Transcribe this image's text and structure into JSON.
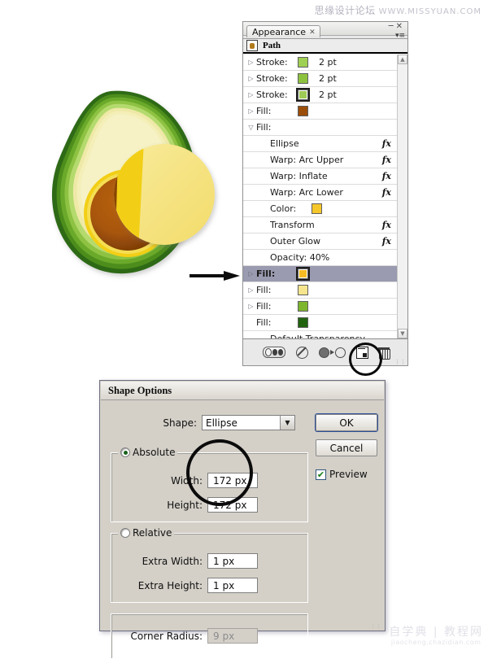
{
  "watermarks": {
    "top_cn": "思缘设计论坛",
    "top_url": "WWW.MISSYUAN.COM",
    "bottom_cn": "自学典 | 教程网",
    "bottom_url": "jiaocheng.chazidian.com"
  },
  "artwork": {
    "name": "avocado-illustration",
    "colors": {
      "skin_dark": "#3e7a1c",
      "skin_mid": "#6aa92b",
      "skin_light": "#9ccc4f",
      "flesh_pale": "#f3efb2",
      "flesh_yellow": "#f6e98f",
      "rim_yellow": "#f4d21f",
      "pit_dark": "#7a3d06",
      "pit_mid": "#a8560a",
      "ellipse_yellow": "#f6e37a",
      "ellipse_band": "#f2cf16"
    }
  },
  "appearance_panel": {
    "window_buttons": [
      "minimize",
      "close"
    ],
    "tab": {
      "label": "Appearance",
      "close_icon": "close-icon"
    },
    "menu_icon": "panel-menu-icon",
    "target_label": "Path",
    "rows": [
      {
        "id": "stroke-1",
        "arrow": "collapsed",
        "label": "Stroke:",
        "swatch": "#9fcf53",
        "ring": false,
        "value": "2 pt",
        "fx": false,
        "indent": false,
        "selected": false
      },
      {
        "id": "stroke-2",
        "arrow": "collapsed",
        "label": "Stroke:",
        "swatch": "#8dc23f",
        "ring": false,
        "value": "2 pt",
        "fx": false,
        "indent": false,
        "selected": false
      },
      {
        "id": "stroke-3",
        "arrow": "collapsed",
        "label": "Stroke:",
        "swatch": "#9ecb55",
        "ring": true,
        "value": "2 pt",
        "fx": false,
        "indent": false,
        "selected": false
      },
      {
        "id": "fill-brown",
        "arrow": "collapsed",
        "label": "Fill:",
        "swatch": "#9a4e09",
        "ring": false,
        "value": "",
        "fx": false,
        "indent": false,
        "selected": false
      },
      {
        "id": "fill-expanded",
        "arrow": "expanded",
        "label": "Fill:",
        "swatch": "",
        "ring": false,
        "value": "",
        "fx": false,
        "indent": false,
        "selected": false
      },
      {
        "id": "effect-ellipse",
        "arrow": "none",
        "label": "Ellipse",
        "swatch": "",
        "ring": false,
        "value": "",
        "fx": true,
        "indent": true,
        "selected": false
      },
      {
        "id": "effect-warp-arc-upper",
        "arrow": "none",
        "label": "Warp: Arc Upper",
        "swatch": "",
        "ring": false,
        "value": "",
        "fx": true,
        "indent": true,
        "selected": false
      },
      {
        "id": "effect-warp-inflate",
        "arrow": "none",
        "label": "Warp: Inflate",
        "swatch": "",
        "ring": false,
        "value": "",
        "fx": true,
        "indent": true,
        "selected": false
      },
      {
        "id": "effect-warp-arc-lower",
        "arrow": "none",
        "label": "Warp: Arc Lower",
        "swatch": "",
        "ring": false,
        "value": "",
        "fx": true,
        "indent": true,
        "selected": false
      },
      {
        "id": "effect-color",
        "arrow": "none",
        "label": "Color:",
        "swatch": "#f5c72b",
        "ring": false,
        "value": "",
        "fx": false,
        "indent": true,
        "selected": false
      },
      {
        "id": "effect-transform",
        "arrow": "none",
        "label": "Transform",
        "swatch": "",
        "ring": false,
        "value": "",
        "fx": true,
        "indent": true,
        "selected": false
      },
      {
        "id": "effect-outer-glow",
        "arrow": "none",
        "label": "Outer Glow",
        "swatch": "",
        "ring": false,
        "value": "",
        "fx": true,
        "indent": true,
        "selected": false
      },
      {
        "id": "effect-opacity",
        "arrow": "none",
        "label": "Opacity: 40%",
        "swatch": "",
        "ring": false,
        "value": "",
        "fx": false,
        "indent": true,
        "selected": false
      },
      {
        "id": "fill-selected",
        "arrow": "collapsed",
        "label": "Fill:",
        "swatch": "#f5bc24",
        "ring": true,
        "value": "",
        "fx": false,
        "indent": false,
        "selected": true
      },
      {
        "id": "fill-pale",
        "arrow": "collapsed",
        "label": "Fill:",
        "swatch": "#f7e58e",
        "ring": false,
        "value": "",
        "fx": false,
        "indent": false,
        "selected": false
      },
      {
        "id": "fill-green",
        "arrow": "collapsed",
        "label": "Fill:",
        "swatch": "#7db52f",
        "ring": false,
        "value": "",
        "fx": false,
        "indent": false,
        "selected": false
      },
      {
        "id": "fill-dark-green",
        "arrow": "none",
        "label": "Fill:",
        "swatch": "#21630f",
        "ring": false,
        "value": "",
        "fx": false,
        "indent": false,
        "selected": false
      },
      {
        "id": "default-transparency",
        "arrow": "none",
        "label": "Default Transparency",
        "swatch": "",
        "ring": false,
        "value": "",
        "fx": false,
        "indent": true,
        "selected": false
      }
    ],
    "footer_buttons": [
      {
        "id": "new-art-has-basic-appearance",
        "icon": "new-art-basic-appearance-icon"
      },
      {
        "id": "clear-appearance",
        "icon": "clear-appearance-icon"
      },
      {
        "id": "reduce-to-basic-appearance",
        "icon": "reduce-to-basic-appearance-icon"
      },
      {
        "id": "duplicate-selected-item",
        "icon": "duplicate-item-icon"
      },
      {
        "id": "delete-selected-item",
        "icon": "trash-icon"
      }
    ]
  },
  "shape_dialog": {
    "title": "Shape Options",
    "shape": {
      "label": "Shape:",
      "value": "Ellipse",
      "caret": "chevron-down-icon"
    },
    "absolute": {
      "legend": "Absolute",
      "selected": true,
      "width": {
        "label": "Width:",
        "value": "172 px"
      },
      "height": {
        "label": "Height:",
        "value": "172 px"
      }
    },
    "relative": {
      "legend": "Relative",
      "selected": false,
      "extra_width": {
        "label": "Extra Width:",
        "value": "1 px"
      },
      "extra_height": {
        "label": "Extra Height:",
        "value": "1 px"
      }
    },
    "corner": {
      "label": "Corner Radius:",
      "value": "9 px",
      "disabled": true
    },
    "buttons": {
      "ok": "OK",
      "cancel": "Cancel"
    },
    "preview": {
      "label": "Preview",
      "checked": true,
      "check_glyph": "✔"
    }
  }
}
